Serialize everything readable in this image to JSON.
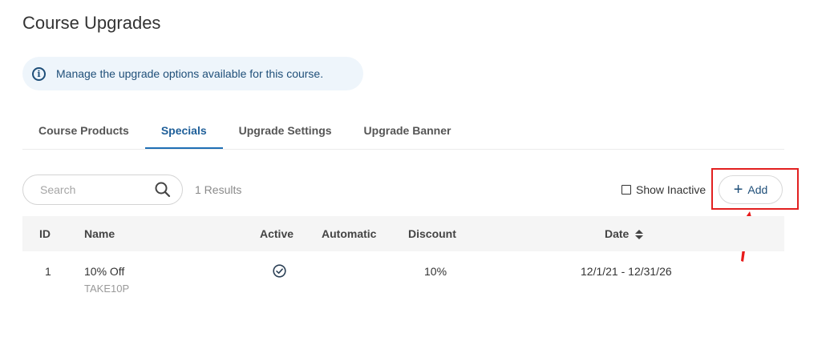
{
  "page": {
    "title": "Course Upgrades",
    "info": "Manage the upgrade options available for this course."
  },
  "tabs": [
    {
      "label": "Course Products",
      "active": false
    },
    {
      "label": "Specials",
      "active": true
    },
    {
      "label": "Upgrade Settings",
      "active": false
    },
    {
      "label": "Upgrade Banner",
      "active": false
    }
  ],
  "toolbar": {
    "search_placeholder": "Search",
    "results": "1 Results",
    "show_inactive_label": "Show Inactive",
    "add_label": "Add"
  },
  "table": {
    "columns": [
      "ID",
      "Name",
      "Active",
      "Automatic",
      "Discount",
      "Date"
    ],
    "rows": [
      {
        "id": "1",
        "name": "10% Off",
        "code": "TAKE10P",
        "active": true,
        "automatic": "",
        "discount": "10%",
        "date": "12/1/21 - 12/31/26"
      }
    ]
  },
  "colors": {
    "accent": "#1f4f79",
    "tab_active": "#1f6fb5",
    "annotation": "#e22020",
    "info_bg": "#eef5fb"
  },
  "icons": {
    "info": "info-icon",
    "search": "search-icon",
    "add": "plus-icon",
    "sort": "sort-icon",
    "active": "check-circle-icon"
  }
}
